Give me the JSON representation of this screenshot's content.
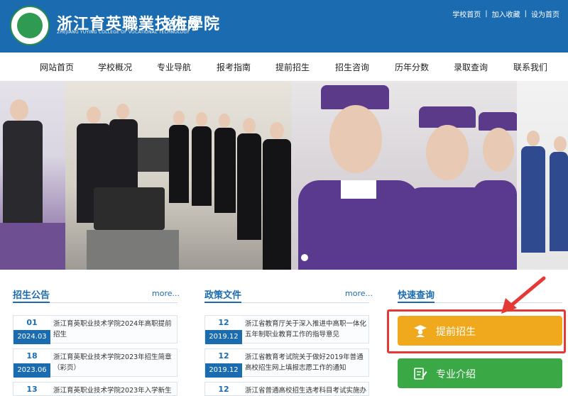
{
  "header": {
    "logo_cn": "浙江育英職業技術學院",
    "logo_en": "ZHEJIANG YUYING COLLEGE OF VOCATIONAL TECHNOLOGY",
    "site_suffix": "招生网",
    "top_links": [
      "学校首页",
      "加入收藏",
      "设为首页"
    ]
  },
  "nav": {
    "items": [
      "网站首页",
      "学校概况",
      "专业导航",
      "报考指南",
      "提前招生",
      "招生咨询",
      "历年分数",
      "录取查询",
      "联系我们"
    ]
  },
  "admissions": {
    "title": "招生公告",
    "more": "more...",
    "items": [
      {
        "day": "01",
        "ym": "2024.03",
        "text": "浙江育英职业技术学院2024年高职提前招生"
      },
      {
        "day": "18",
        "ym": "2023.06",
        "text": "浙江育英职业技术学院2023年招生简章（彩页）"
      },
      {
        "day": "13",
        "ym": "",
        "text": "浙江育英职业技术学院2023年入学新生学"
      }
    ]
  },
  "policy": {
    "title": "政策文件",
    "more": "more...",
    "items": [
      {
        "day": "12",
        "ym": "2019.12",
        "text": "浙江省教育厅关于深入推进中高职一体化五年制职业教育工作的指导意见"
      },
      {
        "day": "12",
        "ym": "2019.12",
        "text": "浙江省教育考试院关于做好2019年普通高校招生网上填报志愿工作的通知"
      },
      {
        "day": "12",
        "ym": "",
        "text": "浙江省普通高校招生选考科目考试实施办法"
      }
    ]
  },
  "quick": {
    "title": "快速查询",
    "buttons": [
      {
        "label": "提前招生",
        "icon": "graduate-icon",
        "color": "#f0a81c"
      },
      {
        "label": "专业介绍",
        "icon": "edit-document-icon",
        "color": "#39a845"
      }
    ]
  },
  "colors": {
    "brand": "#1b6bb0",
    "highlight": "#e53935"
  }
}
